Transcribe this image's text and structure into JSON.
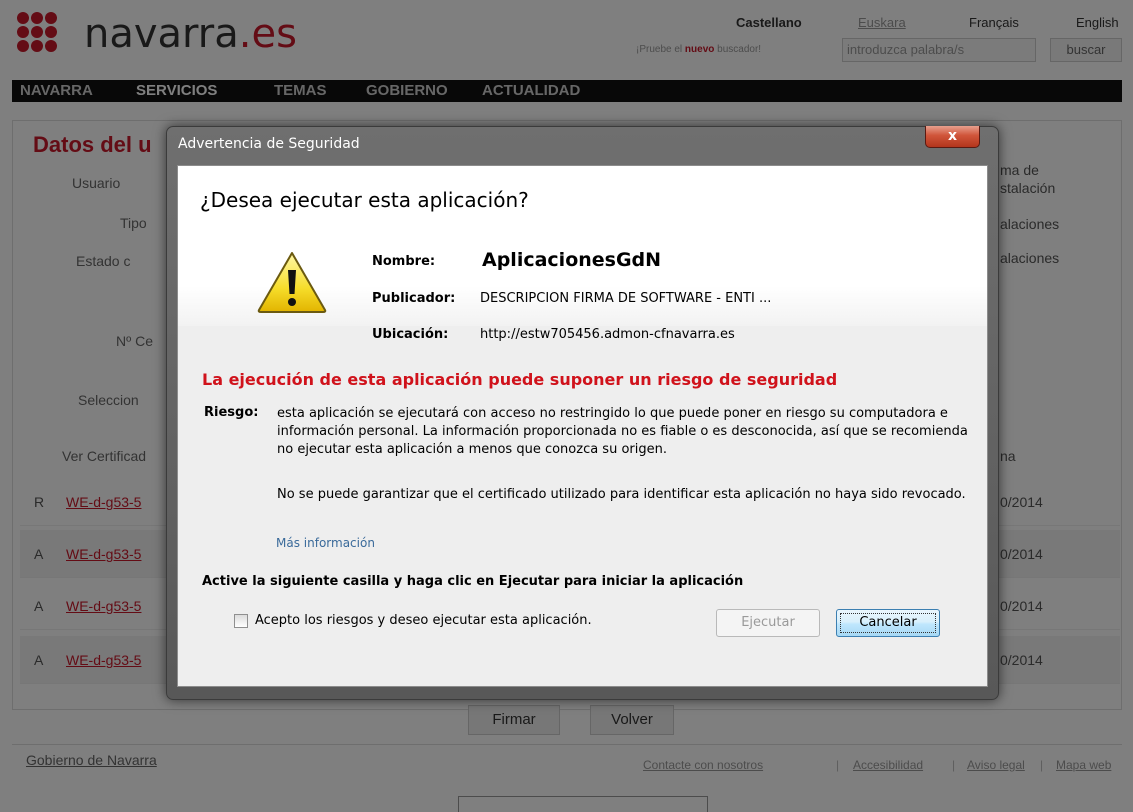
{
  "site": {
    "logo_text": "navarra",
    "logo_suffix": ".es",
    "languages": [
      "Castellano",
      "Euskara",
      "Français",
      "English"
    ],
    "search_hint_prefix": "¡Pruebe el",
    "search_hint_new": "nuevo",
    "search_hint_suffix": "buscador!",
    "search_placeholder": "introduzca palabra/s",
    "search_button": "buscar"
  },
  "nav": {
    "items": [
      "NAVARRA",
      "SERVICIOS",
      "TEMAS",
      "GOBIERNO",
      "ACTUALIDAD"
    ]
  },
  "background": {
    "title": "Datos del u",
    "labels": [
      "Usuario",
      "Tipo",
      "Estado c",
      "Nº Ce",
      "Seleccion",
      "Ver Certificad"
    ],
    "right_texts": [
      "ma de",
      "stalación",
      "alaciones",
      "alaciones",
      "na"
    ],
    "rows": [
      {
        "flag": "R",
        "link": "WE-d-g53-5",
        "date": "0/2014"
      },
      {
        "flag": "A",
        "link": "WE-d-g53-5",
        "date": "0/2014"
      },
      {
        "flag": "A",
        "link": "WE-d-g53-5",
        "date": "0/2014"
      },
      {
        "flag": "A",
        "link": "WE-d-g53-5",
        "date": "0/2014"
      }
    ],
    "sign_button": "Firmar",
    "back_button": "Volver",
    "footer_left": "Gobierno de Navarra",
    "footer_links": [
      "Contacte con nosotros",
      "Accesibilidad",
      "Aviso legal",
      "Mapa web"
    ]
  },
  "dialog": {
    "title": "Advertencia de Seguridad",
    "close_glyph": "x",
    "heading": "¿Desea ejecutar esta aplicación?",
    "name_label": "Nombre:",
    "name_value": "AplicacionesGdN",
    "publisher_label": "Publicador:",
    "publisher_value": "DESCRIPCION FIRMA DE SOFTWARE - ENTI ...",
    "location_label": "Ubicación:",
    "location_value": "http://estw705456.admon-cfnavarra.es",
    "risk_heading": "La ejecución de esta aplicación puede suponer un riesgo de seguridad",
    "risk_label": "Riesgo:",
    "risk_text": "esta aplicación se ejecutará con acceso no restringido lo que puede poner en riesgo su computadora e información personal. La información proporcionada no es fiable o es desconocida, así que se recomienda no ejecutar esta aplicación a menos que conozca su origen.",
    "revoke_text": "No se puede garantizar que el certificado utilizado para identificar esta aplicación no haya sido revocado.",
    "more_info": "Más información",
    "instructions": "Active la siguiente casilla y haga clic en Ejecutar para iniciar la aplicación",
    "checkbox_label": "Acepto los riesgos y deseo ejecutar esta aplicación.",
    "checkbox_checked": false,
    "run_button": "Ejecutar",
    "cancel_button": "Cancelar",
    "icon": "warning-icon"
  },
  "colors": {
    "brand_red": "#c8182a",
    "risk_red": "#d0121b",
    "close_red": "#c94a30",
    "primary_button": "#bee6fd"
  }
}
